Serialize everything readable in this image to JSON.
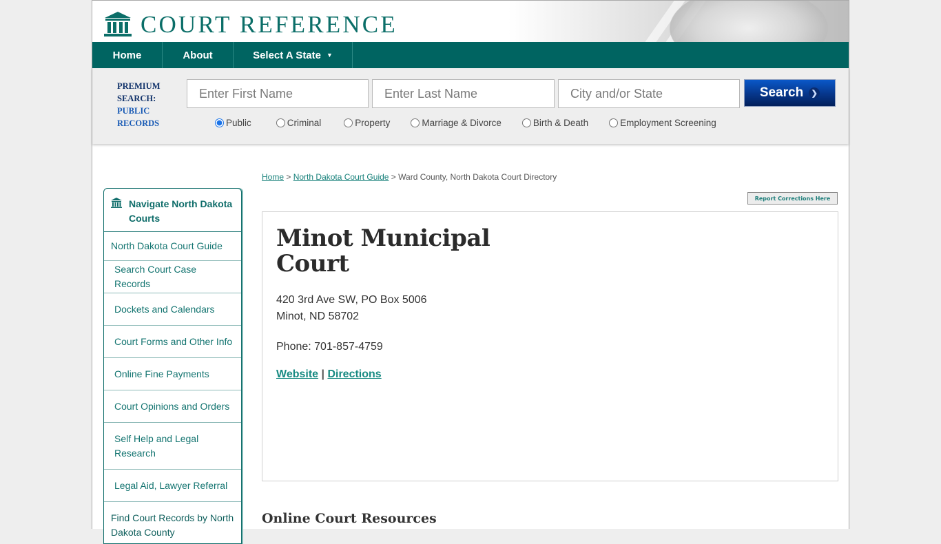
{
  "site": {
    "logo_text": "COURT REFERENCE",
    "logo_icon": "courthouse-icon"
  },
  "nav": {
    "items": [
      {
        "label": "Home"
      },
      {
        "label": "About"
      },
      {
        "label": "Select A State",
        "caret": "▼"
      }
    ]
  },
  "search": {
    "premium_line1": "PREMIUM",
    "premium_line2": "SEARCH:",
    "premium_line3": "PUBLIC",
    "premium_line4": "RECORDS",
    "first_name_placeholder": "Enter First Name",
    "first_name_value": "",
    "last_name_placeholder": "Enter Last Name",
    "last_name_value": "",
    "city_placeholder": "City and/or State",
    "city_value": "",
    "button_label": "Search",
    "button_icon": "chevron-right-icon",
    "record_types": [
      {
        "label": "Public",
        "checked": true
      },
      {
        "label": "Criminal",
        "checked": false
      },
      {
        "label": "Property",
        "checked": false
      },
      {
        "label": "Marriage & Divorce",
        "checked": false
      },
      {
        "label": "Birth & Death",
        "checked": false
      },
      {
        "label": "Employment Screening",
        "checked": false
      }
    ]
  },
  "breadcrumb": {
    "items": [
      {
        "label": "Home",
        "link": true
      },
      {
        "label": "North Dakota Court Guide",
        "link": true
      },
      {
        "label": "Ward County, North Dakota Court Directory",
        "link": false
      }
    ],
    "separator": ">"
  },
  "report_button": "Report Corrections Here",
  "sidebar": {
    "heading": "Navigate North Dakota Courts",
    "items": [
      {
        "label": "North Dakota Court Guide"
      },
      {
        "label": "Search Court Case Records"
      },
      {
        "label": "Dockets and Calendars"
      },
      {
        "label": "Court Forms and Other Info"
      },
      {
        "label": "Online Fine Payments"
      },
      {
        "label": "Court Opinions and Orders"
      },
      {
        "label": "Self Help and Legal Research"
      },
      {
        "label": "Legal Aid, Lawyer Referral"
      },
      {
        "label": "Find Court Records by North Dakota County"
      }
    ]
  },
  "court": {
    "name": "Minot Municipal Court",
    "address_line1": "420 3rd Ave SW, PO Box 5006",
    "address_line2": "Minot, ND 58702",
    "phone": "Phone: 701-857-4759",
    "website_label": "Website",
    "link_separator": "|",
    "directions_label": "Directions"
  },
  "sections": {
    "online_resources": "Online Court Resources"
  },
  "colors": {
    "brand_teal": "#006461",
    "link_teal": "#16807a",
    "search_blue": "#06368a"
  }
}
